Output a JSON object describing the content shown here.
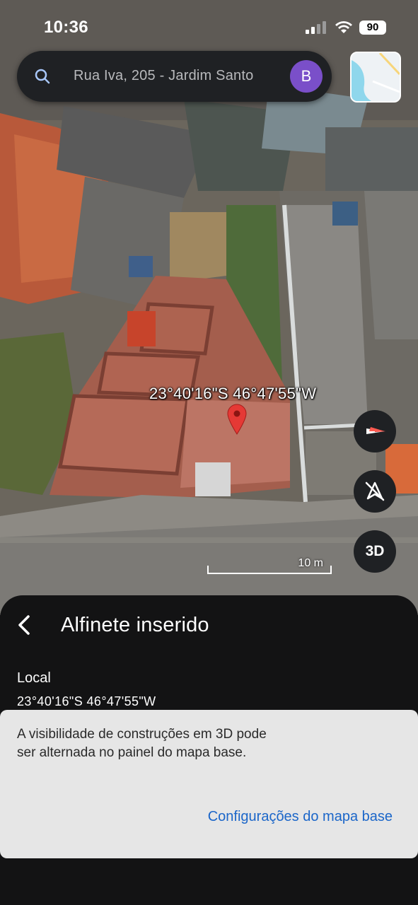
{
  "status_bar": {
    "time": "10:36",
    "battery": "90"
  },
  "search": {
    "text": "Rua Iva, 205 - Jardim Santo",
    "avatar_letter": "B"
  },
  "map": {
    "pin_coordinates": "23°40'16\"S 46°47'55\"W",
    "scale_label": "10 m",
    "button_3d": "3D"
  },
  "sheet": {
    "title": "Alfinete inserido",
    "location_label": "Local",
    "location_value": "23°40'16\"S 46°47'55\"W"
  },
  "snackbar": {
    "message": "A visibilidade de construções em 3D pode ser alternada no painel do mapa base.",
    "action": "Configurações do mapa base"
  },
  "colors": {
    "accent_link": "#1b66c9",
    "avatar": "#7a4fc9",
    "pin": "#e53935",
    "panel": "#1f2124"
  },
  "icons": [
    "search-icon",
    "compass-icon",
    "navigation-off-icon",
    "back-arrow-icon",
    "map-pin-icon",
    "wifi-icon",
    "signal-icon"
  ]
}
